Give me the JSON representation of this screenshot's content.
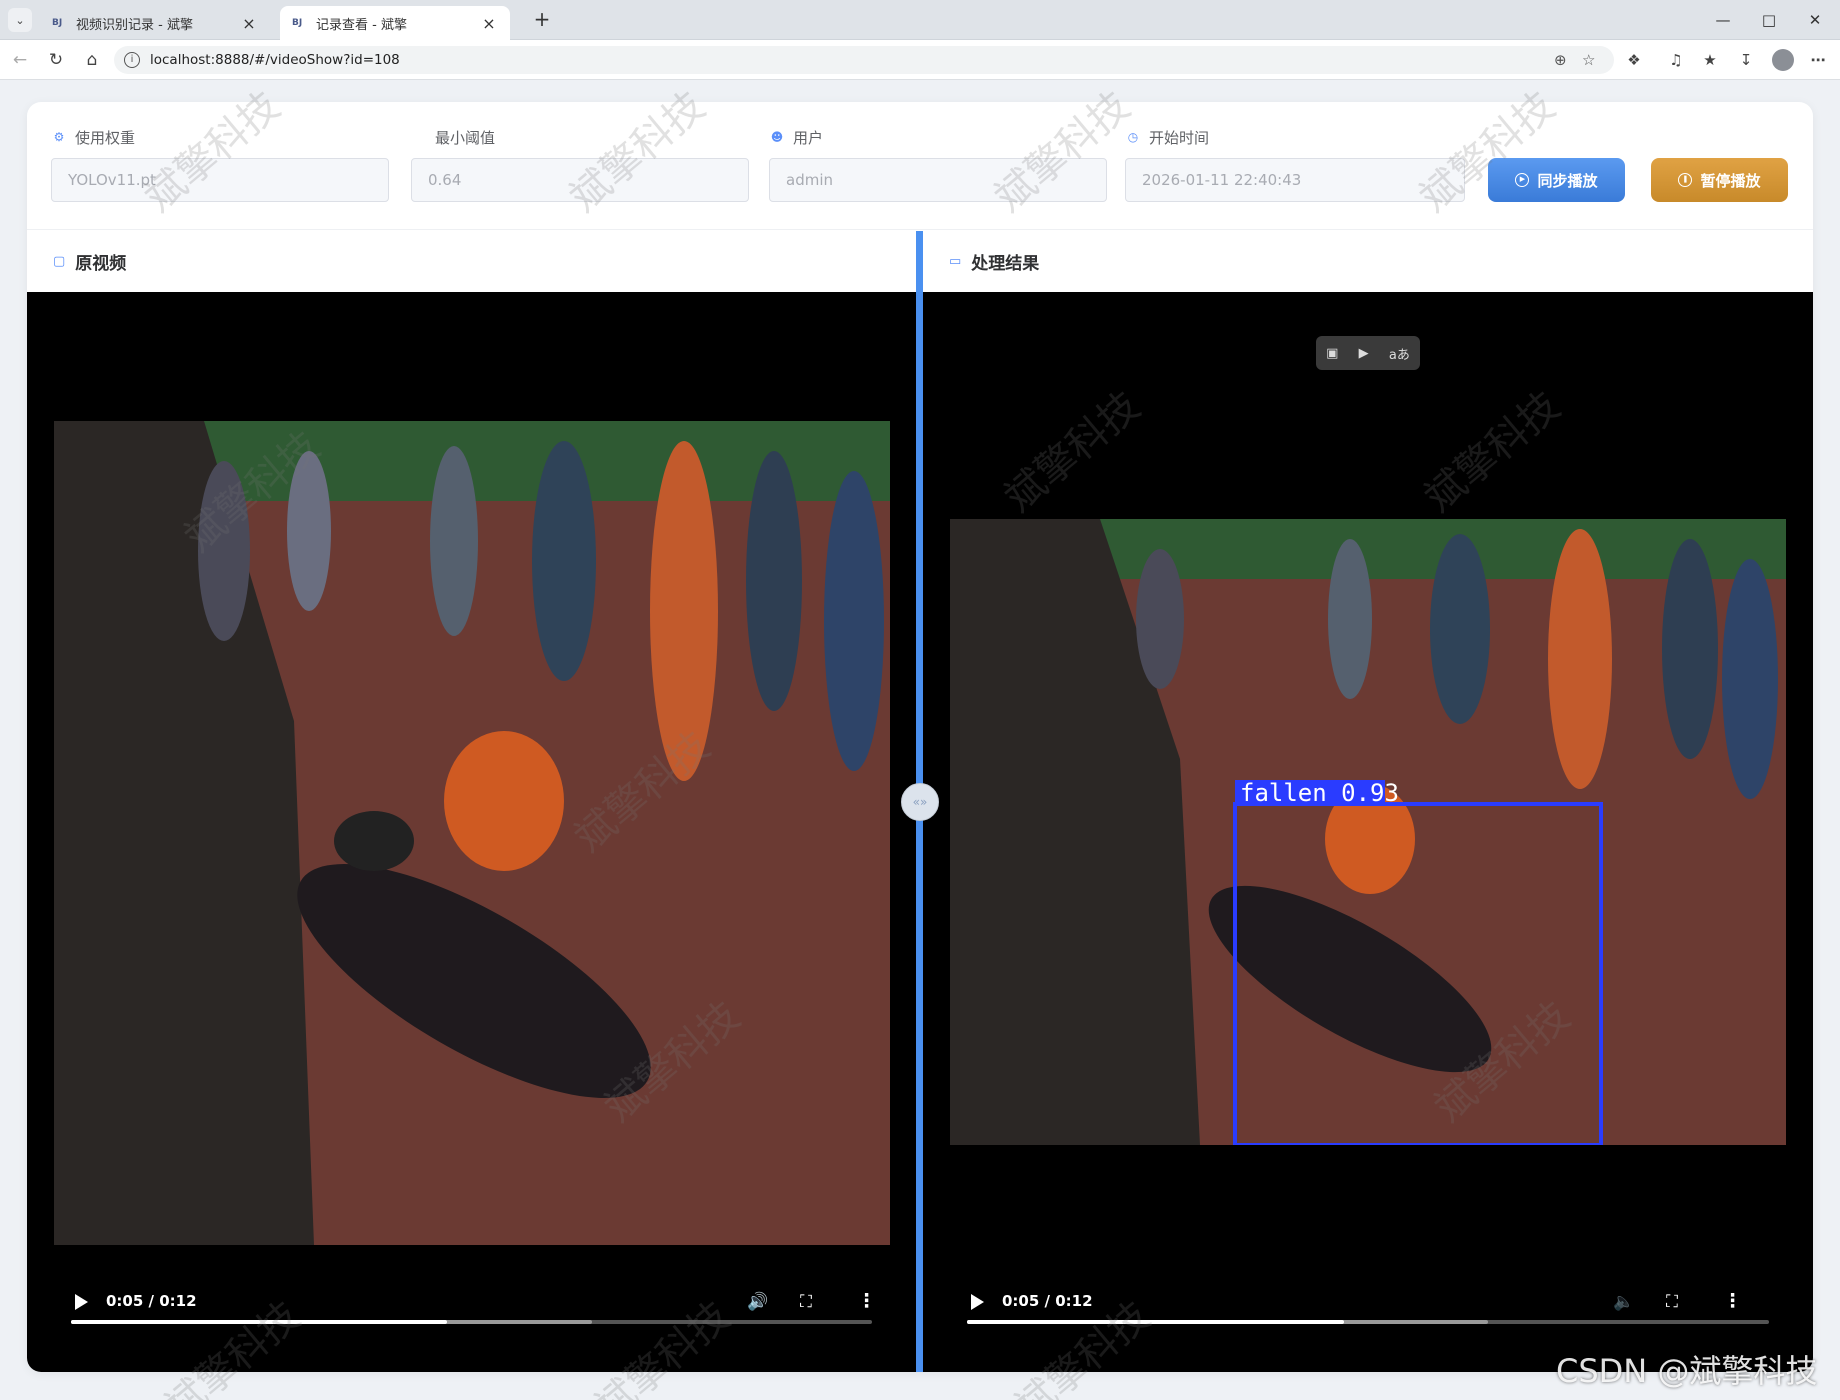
{
  "browser": {
    "tabs": [
      {
        "favicon": "BJ",
        "title": "视频识别记录 - 斌擎",
        "active": false
      },
      {
        "favicon": "BJ",
        "title": "记录查看 - 斌擎",
        "active": true
      }
    ],
    "url": "localhost:8888/#/videoShow?id=108"
  },
  "filters": {
    "weights": {
      "label": "使用权重",
      "value": "YOLOv11.pt"
    },
    "threshold": {
      "label": "最小阈值",
      "value": "0.64"
    },
    "user": {
      "label": "用户",
      "value": "admin"
    },
    "start_time": {
      "label": "开始时间",
      "value": "2026-01-11 22:40:43"
    }
  },
  "actions": {
    "sync_play": "同步播放",
    "pause_play": "暂停播放"
  },
  "panels": {
    "original": {
      "title": "原视频",
      "player": {
        "time": "0:05 / 0:12",
        "played_fraction": 0.47,
        "buffered_fraction": 0.65,
        "muted": false
      }
    },
    "result": {
      "title": "处理结果",
      "detection_label": "fallen 0.93",
      "player": {
        "time": "0:05 / 0:12",
        "played_fraction": 0.47,
        "buffered_fraction": 0.65,
        "muted": true
      }
    }
  },
  "watermark_text": "斌擎科技",
  "footer_watermark": "CSDN @斌擎科技",
  "colors": {
    "accent": "#4a90f0",
    "sync_button": "#3a7bd8",
    "pause_button": "#c88a2a",
    "detection_box": "#2a3cff"
  }
}
